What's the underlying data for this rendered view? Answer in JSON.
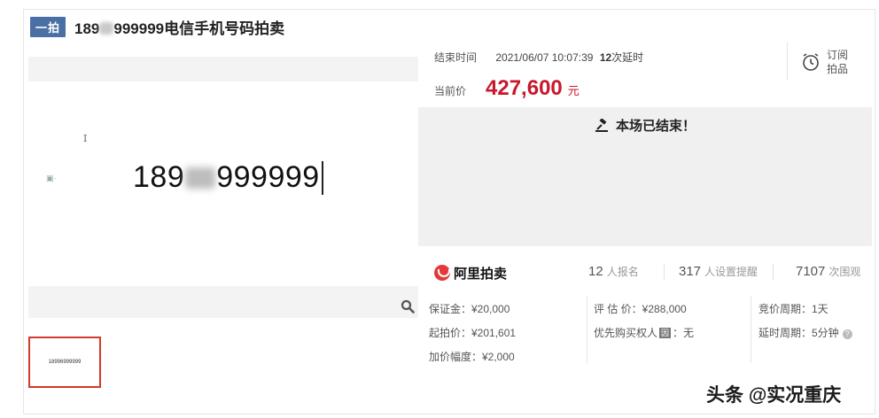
{
  "listing": {
    "tag": "一拍",
    "title_prefix": "189",
    "title_suffix": "999999电信手机号码拍卖"
  },
  "image_area": {
    "number_prefix": "189",
    "number_suffix": "999999",
    "cursor_glyph": "I",
    "thumb_text": "18996999999"
  },
  "auction": {
    "end_label": "结束时间",
    "end_time": "2021/06/07 10:07:39",
    "extensions": "12",
    "extensions_label": "次延时",
    "price_label": "当前价",
    "price": "427,600",
    "price_unit": "元",
    "subscribe_line1": "订阅",
    "subscribe_line2": "拍品",
    "ended_message": "本场已结束！"
  },
  "stats": {
    "brand": "阿里拍卖",
    "signups": "12",
    "signups_label": "人报名",
    "reminders": "317",
    "reminders_label": "人设置提醒",
    "views": "7107",
    "views_label": "次围观"
  },
  "details": {
    "deposit": "保证金：¥20,000",
    "start_price": "起拍价：¥201,601",
    "increment": "加价幅度：¥2,000",
    "assessment": "评 估 价：¥288,000",
    "priority_prefix": "优先购买权人",
    "priority_badge": "因",
    "priority_value": "：无",
    "cycle": "竞价周期：1天",
    "delay_cycle": "延时周期：5分钟"
  },
  "watermark": "头条 @实况重庆",
  "colors": {
    "price": "#c7182c",
    "tag_bg": "#4a6fa5",
    "thumb_border": "#d23a2b",
    "ended_panel": "#f0f0f0"
  }
}
